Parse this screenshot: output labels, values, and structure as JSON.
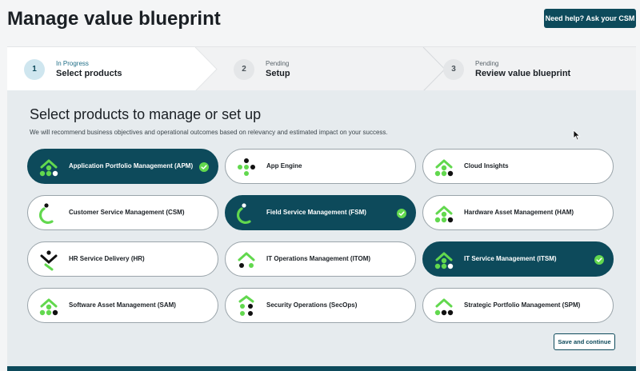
{
  "header": {
    "title": "Manage value blueprint",
    "help_label": "Need help? Ask your CSM"
  },
  "stepper": {
    "steps": [
      {
        "number": "1",
        "status": "In Progress",
        "label": "Select products",
        "active": true
      },
      {
        "number": "2",
        "status": "Pending",
        "label": "Setup",
        "active": false
      },
      {
        "number": "3",
        "status": "Pending",
        "label": "Review value blueprint",
        "active": false
      }
    ]
  },
  "main": {
    "title": "Select products to manage or set up",
    "subtitle": "We will recommend business objectives and operational outcomes based on relevancy and estimated impact on your success.",
    "products": [
      {
        "label": "Application Portfolio Management (APM)",
        "selected": true,
        "icon": "apm-logo-icon"
      },
      {
        "label": "App Engine",
        "selected": false,
        "icon": "app-engine-logo-icon"
      },
      {
        "label": "Cloud Insights",
        "selected": false,
        "icon": "cloud-insights-logo-icon"
      },
      {
        "label": "Customer Service Management (CSM)",
        "selected": false,
        "icon": "csm-logo-icon"
      },
      {
        "label": "Field Service Management (FSM)",
        "selected": true,
        "icon": "fsm-logo-icon"
      },
      {
        "label": "Hardware Asset Management (HAM)",
        "selected": false,
        "icon": "ham-logo-icon"
      },
      {
        "label": "HR Service Delivery (HR)",
        "selected": false,
        "icon": "hr-logo-icon"
      },
      {
        "label": "IT Operations Management (ITOM)",
        "selected": false,
        "icon": "itom-logo-icon"
      },
      {
        "label": "IT Service Management (ITSM)",
        "selected": true,
        "icon": "itsm-logo-icon"
      },
      {
        "label": "Software Asset Management (SAM)",
        "selected": false,
        "icon": "sam-logo-icon"
      },
      {
        "label": "Security Operations (SecOps)",
        "selected": false,
        "icon": "secops-logo-icon"
      },
      {
        "label": "Strategic Portfolio Management (SPM)",
        "selected": false,
        "icon": "spm-logo-icon"
      }
    ],
    "save_label": "Save and continue"
  },
  "colors": {
    "primary": "#0d4a5b",
    "accent_green": "#62d84e",
    "panel_bg": "#e6ebee"
  }
}
